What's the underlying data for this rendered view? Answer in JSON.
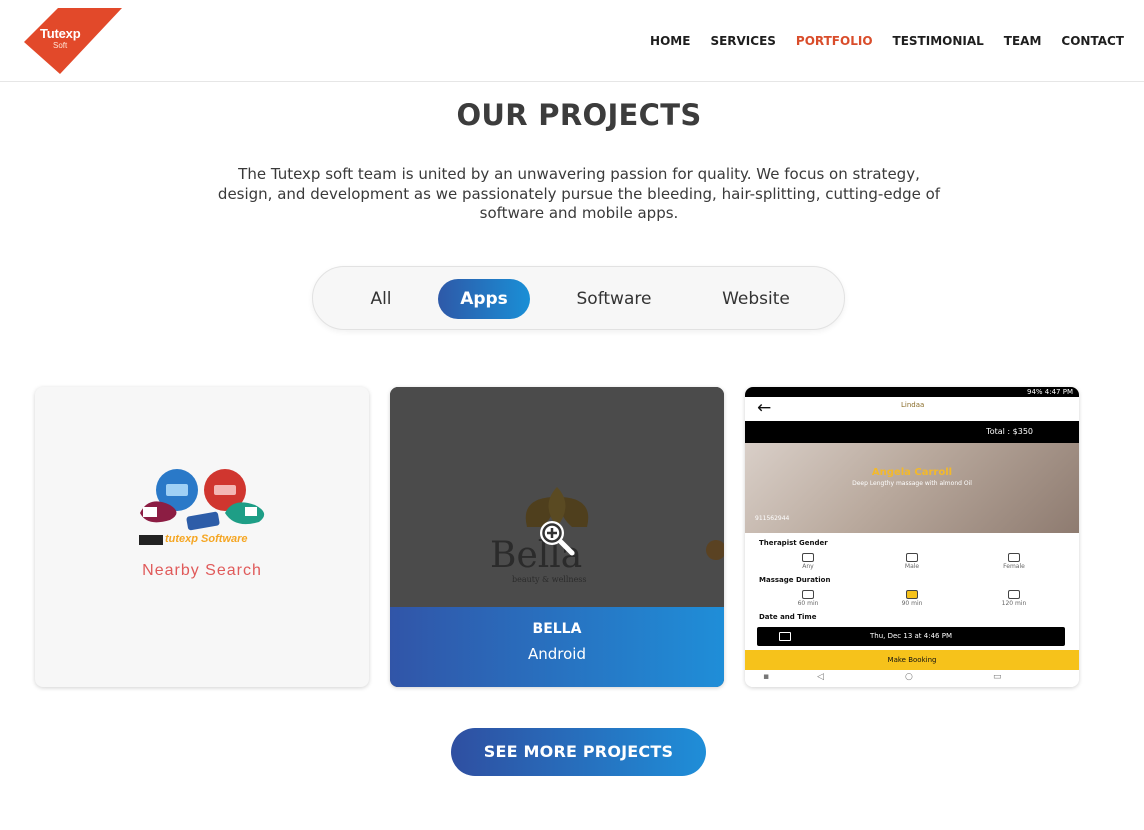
{
  "header": {
    "logo": {
      "line1": "Tutexp",
      "line2": "Soft",
      "color": "#e2492a"
    },
    "nav": [
      {
        "label": "HOME",
        "active": false
      },
      {
        "label": "SERVICES",
        "active": false
      },
      {
        "label": "PORTFOLIO",
        "active": true
      },
      {
        "label": "TESTIMONIAL",
        "active": false
      },
      {
        "label": "TEAM",
        "active": false
      },
      {
        "label": "CONTACT",
        "active": false
      }
    ]
  },
  "section": {
    "title": "OUR PROJECTS",
    "description": "The Tutexp soft team is united by an unwavering passion for quality. We focus on strategy, design, and development as we passionately pursue the bleeding, hair-splitting, cutting-edge of software and mobile apps."
  },
  "filters": [
    {
      "label": "All",
      "active": false
    },
    {
      "label": "Apps",
      "active": true
    },
    {
      "label": "Software",
      "active": false
    },
    {
      "label": "Website",
      "active": false
    }
  ],
  "projects": [
    {
      "image_brand": "tutexp Software",
      "image_caption": "Nearby Search"
    },
    {
      "logo_word": "Bella",
      "logo_sub": "beauty & wellness",
      "title": "BELLA",
      "platform": "Android",
      "zoom_icon": "zoom-in-icon"
    },
    {
      "status_right": "94% 4:47 PM",
      "app_name": "Lindaa",
      "total": "Total : $350",
      "therapist_name": "Angela Carroll",
      "therapist_desc": "Deep Lengthy massage with almond Oil",
      "phone": "911562944",
      "gender_label": "Therapist Gender",
      "gender_options": [
        "Any",
        "Male",
        "Female"
      ],
      "duration_label": "Massage Duration",
      "duration_options": [
        "60 min",
        "90 min",
        "120 min"
      ],
      "datetime_label": "Date and Time",
      "datetime_value": "Thu, Dec 13 at 4:46 PM",
      "book_label": "Make Booking"
    }
  ],
  "cta": {
    "label": "SEE MORE PROJECTS"
  },
  "colors": {
    "accent": "#d94d2b",
    "gradient_start": "#2e59a8",
    "gradient_end": "#1a8fd6"
  }
}
